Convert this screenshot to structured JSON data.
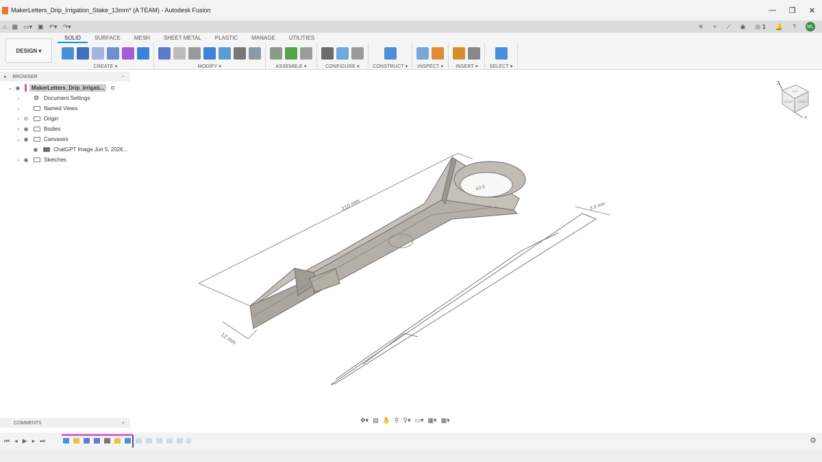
{
  "window": {
    "title": "MakerLetters_Drip_Irrigation_Stake_13mm* (A TEAM) - Autodesk Fusion",
    "minimize": "—",
    "restore": "❐",
    "close": "✕"
  },
  "qat": {
    "job_count": "1",
    "avatar_initials": "ML"
  },
  "workspace": {
    "label": "DESIGN ▾"
  },
  "tabs": [
    "SOLID",
    "SURFACE",
    "MESH",
    "SHEET METAL",
    "PLASTIC",
    "MANAGE",
    "UTILITIES"
  ],
  "groups": [
    {
      "label": "CREATE ▾",
      "icons": [
        "sketch-icon",
        "extrude-icon",
        "revolve-icon",
        "sweep-icon",
        "form-icon",
        "box-icon"
      ]
    },
    {
      "label": "MODIFY ▾",
      "icons": [
        "press-pull-icon",
        "fillet-icon",
        "chamfer-icon",
        "combine-icon",
        "shell-icon",
        "move-icon",
        "parameters-icon"
      ]
    },
    {
      "label": "ASSEMBLE ▾",
      "icons": [
        "joint-icon",
        "component-icon",
        "motion-icon"
      ]
    },
    {
      "label": "CONFIGURE ▾",
      "icons": [
        "configure-icon",
        "table-icon",
        "theme-icon"
      ]
    },
    {
      "label": "CONSTRUCT ▾",
      "icons": [
        "plane-icon"
      ]
    },
    {
      "label": "INSPECT ▾",
      "icons": [
        "measure-icon",
        "section-icon"
      ]
    },
    {
      "label": "INSERT ▾",
      "icons": [
        "insert-icon",
        "canvas-icon"
      ]
    },
    {
      "label": "SELECT ▾",
      "icons": [
        "select-icon"
      ]
    }
  ],
  "browser": {
    "title": "BROWSER",
    "root": "MakerLetters_Drip_Irrigati...",
    "items": [
      {
        "label": "Document Settings",
        "icon": "gear-icon"
      },
      {
        "label": "Named Views",
        "icon": "folder-icon"
      },
      {
        "label": "Origin",
        "icon": "folder-icon"
      },
      {
        "label": "Bodies",
        "icon": "folder-icon"
      },
      {
        "label": "Canvases",
        "icon": "folder-icon"
      },
      {
        "label": "ChatGPT Image Jun 5, 202€...",
        "icon": "image-icon"
      },
      {
        "label": "Sketches",
        "icon": "folder-icon"
      }
    ]
  },
  "comments": {
    "label": "COMMENTS",
    "add": "+"
  },
  "dimensions": {
    "length": "210 mm",
    "width": "12 mm",
    "diameter": "⌀3.5",
    "tip": "3.9 mm"
  },
  "viewcube": {
    "top": "TOP",
    "front": "FRONT",
    "right": "RIGHT",
    "x": "X",
    "z": "Z"
  },
  "colors": {
    "accent": "#0696d7",
    "model_fill": "#b9b4ab",
    "model_stroke": "#555555"
  }
}
